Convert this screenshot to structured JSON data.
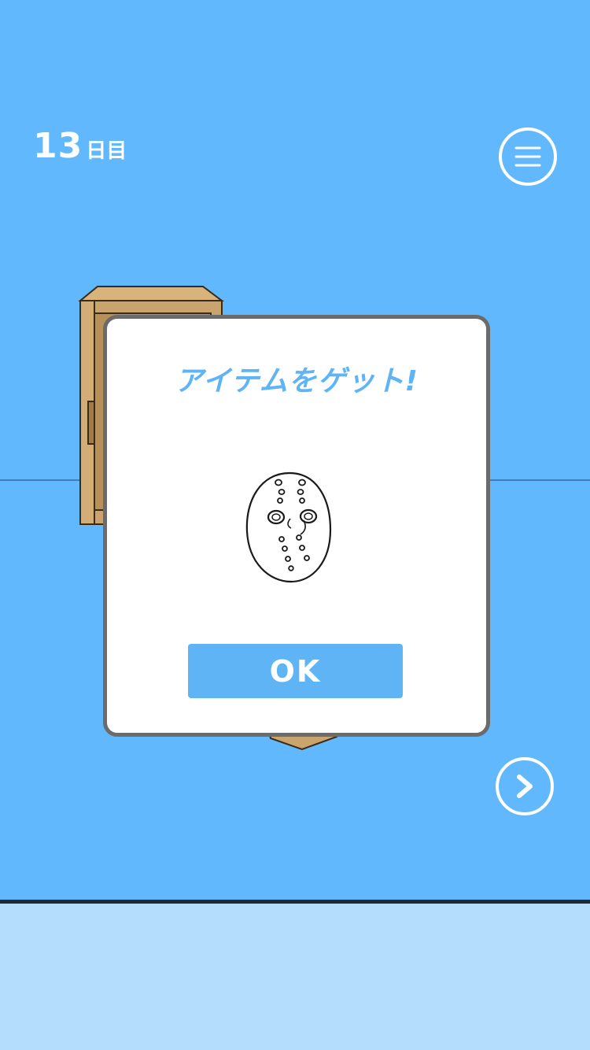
{
  "hud": {
    "day_number": "13",
    "day_unit": "日目",
    "menu_icon": "hamburger-menu-icon",
    "next_icon": "chevron-right-icon"
  },
  "dialog": {
    "title": "アイテムをゲット!",
    "item_icon": "hockey-mask",
    "ok_label": "OK"
  },
  "colors": {
    "background": "#62b8fc",
    "inventory_bar": "#b3dcfd",
    "accent": "#5fb4f6",
    "dialog_border": "#6b6b6b",
    "cabinet_wood": "#c9a46e"
  }
}
